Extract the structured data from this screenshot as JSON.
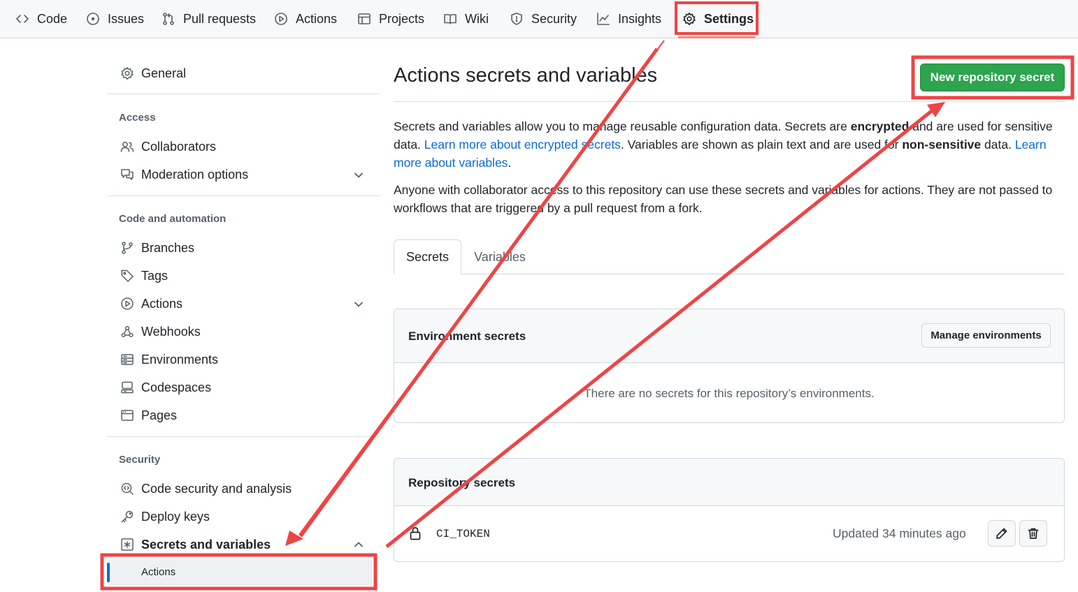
{
  "colors": {
    "accent_blue": "#0969da",
    "primary_green": "#2da44e",
    "annotation_red": "#ef4444",
    "tab_underline": "#fd8c73"
  },
  "topnav": {
    "tabs": [
      {
        "label": "Code",
        "icon": "code-icon"
      },
      {
        "label": "Issues",
        "icon": "issue-opened-icon"
      },
      {
        "label": "Pull requests",
        "icon": "git-pull-request-icon"
      },
      {
        "label": "Actions",
        "icon": "play-icon"
      },
      {
        "label": "Projects",
        "icon": "table-icon"
      },
      {
        "label": "Wiki",
        "icon": "book-icon"
      },
      {
        "label": "Security",
        "icon": "shield-icon"
      },
      {
        "label": "Insights",
        "icon": "graph-icon"
      },
      {
        "label": "Settings",
        "icon": "gear-icon",
        "active": true
      }
    ]
  },
  "sidebar": {
    "general": "General",
    "access_heading": "Access",
    "collaborators": "Collaborators",
    "moderation": "Moderation options",
    "code_heading": "Code and automation",
    "branches": "Branches",
    "tags": "Tags",
    "actions": "Actions",
    "webhooks": "Webhooks",
    "environments": "Environments",
    "codespaces": "Codespaces",
    "pages": "Pages",
    "security_heading": "Security",
    "code_security": "Code security and analysis",
    "deploy_keys": "Deploy keys",
    "secrets_variables": "Secrets and variables",
    "secrets_sub_actions": "Actions"
  },
  "main": {
    "title": "Actions secrets and variables",
    "new_secret_button": "New repository secret",
    "intro": {
      "t1": "Secrets and variables allow you to manage reusable configuration data. Secrets are ",
      "b1": "encrypted",
      "t2": " and are used for sensitive data. ",
      "link1": "Learn more about encrypted secrets",
      "t3": ". Variables are shown as plain text and are used for ",
      "b2": "non-sensitive",
      "t4": " data. ",
      "link2": "Learn more about variables",
      "t5": "."
    },
    "access_note": "Anyone with collaborator access to this repository can use these secrets and variables for actions. They are not passed to workflows that are triggered by a pull request from a fork.",
    "tabs": [
      "Secrets",
      "Variables"
    ],
    "env_secrets": {
      "title": "Environment secrets",
      "manage_button": "Manage environments",
      "empty": "There are no secrets for this repository’s environments."
    },
    "repo_secrets": {
      "title": "Repository secrets",
      "items": [
        {
          "name": "CI_TOKEN",
          "updated": "Updated 34 minutes ago"
        }
      ]
    }
  }
}
